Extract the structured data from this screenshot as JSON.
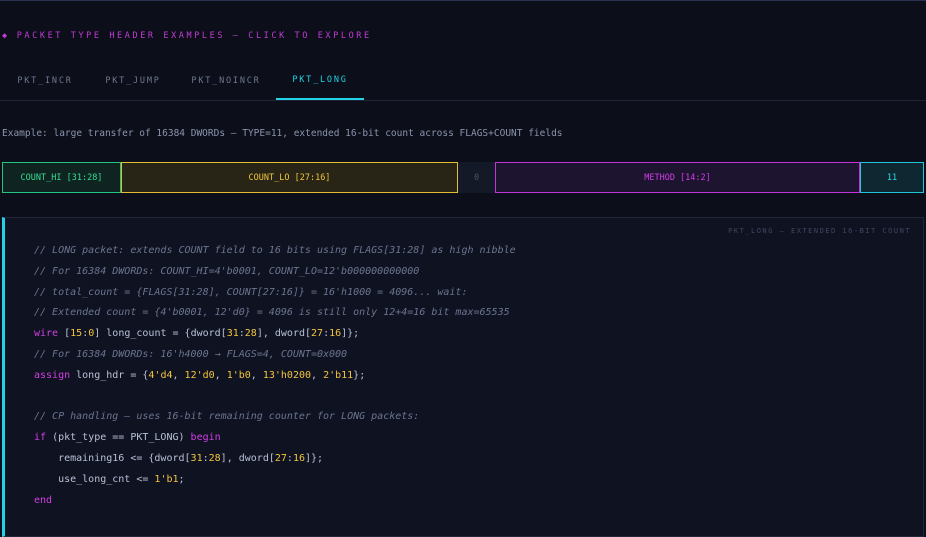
{
  "header": {
    "bullet": "◆",
    "title": "PACKET TYPE HEADER EXAMPLES — CLICK TO EXPLORE"
  },
  "tabs": [
    {
      "label": "PKT_INCR",
      "active": false
    },
    {
      "label": "PKT_JUMP",
      "active": false
    },
    {
      "label": "PKT_NOINCR",
      "active": false
    },
    {
      "label": "PKT_LONG",
      "active": true
    }
  ],
  "description": "Example: large transfer of 16384 DWORDs — TYPE=11, extended 16-bit count across FLAGS+COUNT fields",
  "fields": [
    {
      "label": "COUNT_HI [31:28]",
      "color": "#33dd92"
    },
    {
      "label": "COUNT_LO [27:16]",
      "color": "#f2c53c"
    },
    {
      "label": "0",
      "color": "#4a5268"
    },
    {
      "label": "METHOD [14:2]",
      "color": "#d33de6"
    },
    {
      "label": "11",
      "color": "#2ed6e8"
    }
  ],
  "code_panel": {
    "label": "PKT_LONG — EXTENDED 16-BIT COUNT",
    "lines": [
      [
        {
          "t": "// LONG packet: extends COUNT field to 16 bits using FLAGS[31:28] as high nibble",
          "c": "com"
        }
      ],
      [
        {
          "t": "// For 16384 DWORDs: COUNT_HI=4'b0001, COUNT_LO=12'b000000000000",
          "c": "com"
        }
      ],
      [
        {
          "t": "// total_count = {FLAGS[31:28], COUNT[27:16]} = 16'h1000 = 4096... wait:",
          "c": "com"
        }
      ],
      [
        {
          "t": "// Extended count = {4'b0001, 12'd0} = 4096 is still only 12+4=16 bit max=65535",
          "c": "com"
        }
      ],
      [
        {
          "t": "wire",
          "c": "kw"
        },
        {
          "t": " [",
          "c": ""
        },
        {
          "t": "15",
          "c": "num"
        },
        {
          "t": ":",
          "c": ""
        },
        {
          "t": "0",
          "c": "num"
        },
        {
          "t": "] long_count = {dword[",
          "c": ""
        },
        {
          "t": "31",
          "c": "num"
        },
        {
          "t": ":",
          "c": ""
        },
        {
          "t": "28",
          "c": "num"
        },
        {
          "t": "], dword[",
          "c": ""
        },
        {
          "t": "27",
          "c": "num"
        },
        {
          "t": ":",
          "c": ""
        },
        {
          "t": "16",
          "c": "num"
        },
        {
          "t": "]};",
          "c": ""
        }
      ],
      [
        {
          "t": "// For 16384 DWORDs: 16'h4000 → FLAGS=4, COUNT=0x000",
          "c": "com"
        }
      ],
      [
        {
          "t": "assign",
          "c": "kw"
        },
        {
          "t": " long_hdr = {",
          "c": ""
        },
        {
          "t": "4'd4",
          "c": "num"
        },
        {
          "t": ", ",
          "c": ""
        },
        {
          "t": "12'd0",
          "c": "num"
        },
        {
          "t": ", ",
          "c": ""
        },
        {
          "t": "1'b0",
          "c": "num"
        },
        {
          "t": ", ",
          "c": ""
        },
        {
          "t": "13'h0200",
          "c": "num"
        },
        {
          "t": ", ",
          "c": ""
        },
        {
          "t": "2'b11",
          "c": "num"
        },
        {
          "t": "};",
          "c": ""
        }
      ],
      [],
      [
        {
          "t": "// CP handling — uses 16-bit remaining counter for LONG packets:",
          "c": "com"
        }
      ],
      [
        {
          "t": "if",
          "c": "kw"
        },
        {
          "t": " (pkt_type == PKT_LONG) ",
          "c": ""
        },
        {
          "t": "begin",
          "c": "kw"
        }
      ],
      [
        {
          "t": "    remaining16 <= {dword[",
          "c": ""
        },
        {
          "t": "31",
          "c": "num"
        },
        {
          "t": ":",
          "c": ""
        },
        {
          "t": "28",
          "c": "num"
        },
        {
          "t": "], dword[",
          "c": ""
        },
        {
          "t": "27",
          "c": "num"
        },
        {
          "t": ":",
          "c": ""
        },
        {
          "t": "16",
          "c": "num"
        },
        {
          "t": "]};",
          "c": ""
        }
      ],
      [
        {
          "t": "    use_long_cnt <= ",
          "c": ""
        },
        {
          "t": "1'b1",
          "c": "num"
        },
        {
          "t": ";",
          "c": ""
        }
      ],
      [
        {
          "t": "end",
          "c": "kw"
        }
      ]
    ]
  }
}
